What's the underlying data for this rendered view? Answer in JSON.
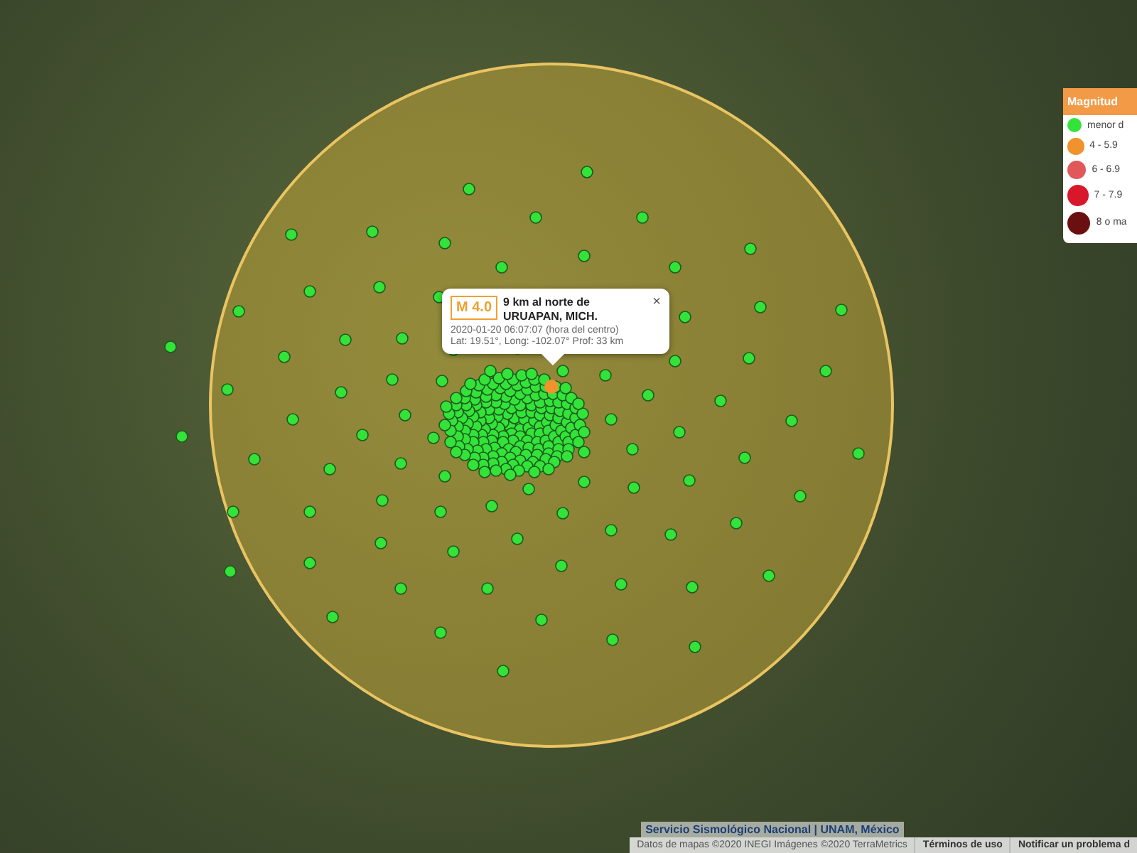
{
  "popup": {
    "magnitude": "M 4.0",
    "location": "9 km al norte de URUAPAN, MICH.",
    "datetime": "2020-01-20   06:07:07 (hora del centro)",
    "coordinates": "Lat: 19.51°, Long: -102.07°  Prof: 33 km",
    "close": "×",
    "color": "#f0922e"
  },
  "legend": {
    "title": "Magnitud",
    "items": [
      {
        "label": "menor d",
        "color": "#33e33a"
      },
      {
        "label": "4 - 5.9",
        "color": "#f0922e"
      },
      {
        "label": "6 - 6.9",
        "color": "#e0585a"
      },
      {
        "label": "7 - 7.9",
        "color": "#d8182a"
      },
      {
        "label": "8 o ma",
        "color": "#6a1010"
      }
    ]
  },
  "footer": {
    "source": "Servicio Sismológico Nacional | UNAM, México",
    "attribution": "Datos de mapas ©2020 INEGI Imágenes ©2020 TerraMetrics",
    "links": [
      "Términos de uso",
      "Notificar un problema d"
    ]
  }
}
